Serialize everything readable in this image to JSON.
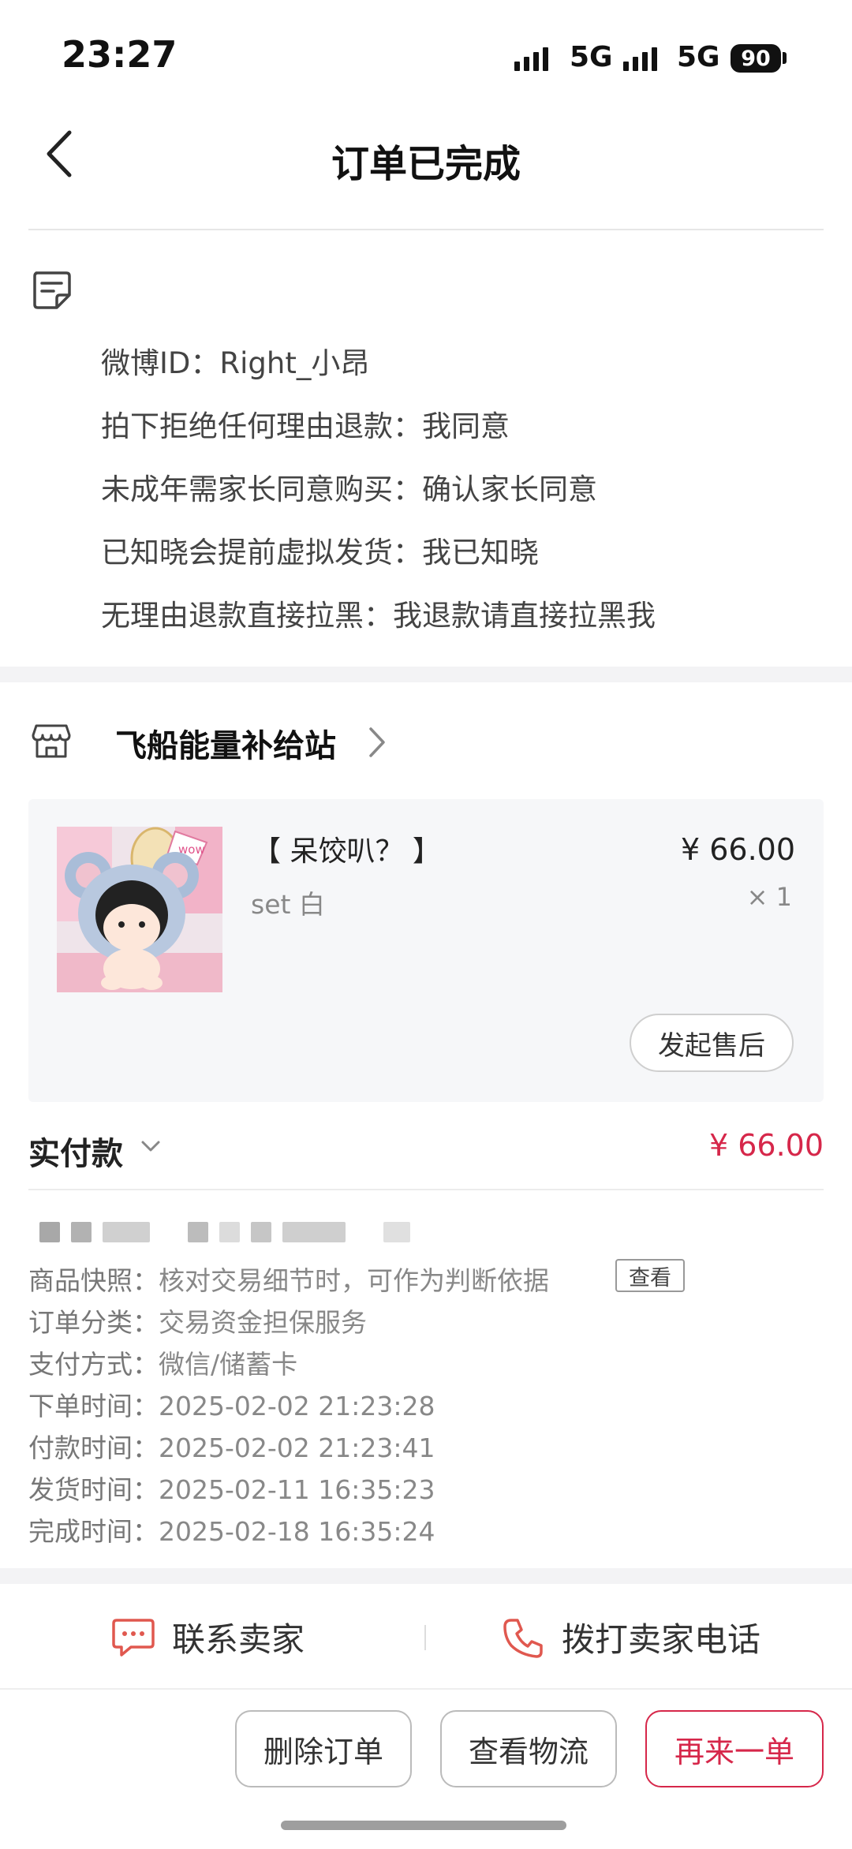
{
  "status_bar": {
    "time": "23:27",
    "net1": "5G",
    "net2": "5G",
    "battery": "90"
  },
  "header": {
    "title": "订单已完成"
  },
  "order_notes": [
    "微博ID：Right_小昂",
    "拍下拒绝任何理由退款：我同意",
    "未成年需家长同意购买：确认家长同意",
    "已知晓会提前虚拟发货：我已知晓",
    "无理由退款直接拉黑：我退款请直接拉黑我"
  ],
  "shop": {
    "name": "飞船能量补给站"
  },
  "product": {
    "name": "【 呆饺叭？ 】",
    "spec": "set 白",
    "price": "¥ 66.00",
    "qty": "× 1",
    "thumb_text": "wow",
    "after_sale_label": "发起售后"
  },
  "payment": {
    "label": "实付款",
    "amount": "¥ 66.00"
  },
  "order_meta": {
    "snapshot_label": "商品快照：",
    "snapshot_value": "核对交易细节时，可作为判断依据",
    "snapshot_btn": "查看",
    "rows": [
      {
        "label": "订单分类：",
        "value": "交易资金担保服务"
      },
      {
        "label": "支付方式：",
        "value": "微信/储蓄卡"
      },
      {
        "label": "下单时间：",
        "value": "2025-02-02 21:23:28"
      },
      {
        "label": "付款时间：",
        "value": "2025-02-02 21:23:41"
      },
      {
        "label": "发货时间：",
        "value": "2025-02-11 16:35:23"
      },
      {
        "label": "完成时间：",
        "value": "2025-02-18 16:35:24"
      }
    ]
  },
  "contact": {
    "chat": "联系卖家",
    "call": "拨打卖家电话"
  },
  "actions": {
    "delete": "删除订单",
    "logistics": "查看物流",
    "reorder": "再来一单"
  },
  "colors": {
    "accent": "#d6274a",
    "separator": "#f3f3f5",
    "card_bg": "#f6f7f9",
    "contact_icon": "#e0584f"
  },
  "icons": [
    "back-arrow-icon",
    "note-icon",
    "shop-icon",
    "chevron-right-icon",
    "chevron-down-icon",
    "chat-icon",
    "phone-icon"
  ]
}
